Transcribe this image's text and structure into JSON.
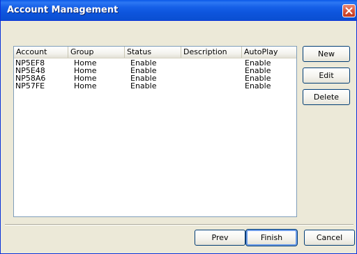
{
  "window": {
    "title": "Account Management"
  },
  "table": {
    "columns": [
      "Account",
      "Group",
      "Status",
      "Description",
      "AutoPlay"
    ],
    "rows": [
      [
        "NP5EF8",
        "Home",
        "Enable",
        "",
        "Enable"
      ],
      [
        "NP5E48",
        "Home",
        "Enable",
        "",
        "Enable"
      ],
      [
        "NP58A6",
        "Home",
        "Enable",
        "",
        "Enable"
      ],
      [
        "NP57FE",
        "Home",
        "Enable",
        "",
        "Enable"
      ]
    ]
  },
  "side_buttons": {
    "new": "New",
    "edit": "Edit",
    "delete": "Delete"
  },
  "footer_buttons": {
    "prev": "Prev",
    "finish": "Finish",
    "cancel": "Cancel"
  },
  "colors": {
    "titlebar": "#0a58e8",
    "close": "#d8553a",
    "dialog_bg": "#ece9d8"
  }
}
